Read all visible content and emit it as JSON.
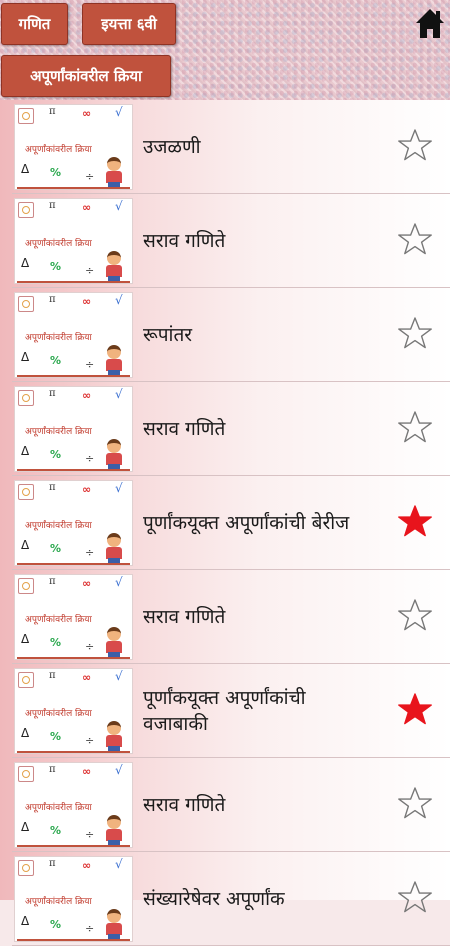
{
  "header": {
    "breadcrumbs": {
      "subject": "गणित",
      "grade": "इयत्ता ६वी",
      "chapter": "अपूर्णांकांवरील क्रिया"
    },
    "home_icon": "home-icon"
  },
  "thumbnail": {
    "title": "अपूर्णांकांवरील क्रिया",
    "symbols": [
      "π",
      "∞",
      "√",
      "Δ",
      "%",
      "÷"
    ]
  },
  "colors": {
    "accent": "#c0523d",
    "star_favorite": "#e8141c",
    "star_outline": "#777777"
  },
  "lessons": [
    {
      "title": "उजळणी",
      "favorite": false
    },
    {
      "title": "सराव गणिते",
      "favorite": false
    },
    {
      "title": "रूपांतर",
      "favorite": false
    },
    {
      "title": "सराव गणिते",
      "favorite": false
    },
    {
      "title": "पूर्णांकयूक्त अपूर्णांकांची बेरीज",
      "favorite": true
    },
    {
      "title": "सराव गणिते",
      "favorite": false
    },
    {
      "title": "पूर्णांकयूक्त अपूर्णांकांची वजाबाकी",
      "favorite": true
    },
    {
      "title": "सराव गणिते",
      "favorite": false
    },
    {
      "title": "संख्यारेषेवर अपूर्णांक",
      "favorite": false
    }
  ]
}
